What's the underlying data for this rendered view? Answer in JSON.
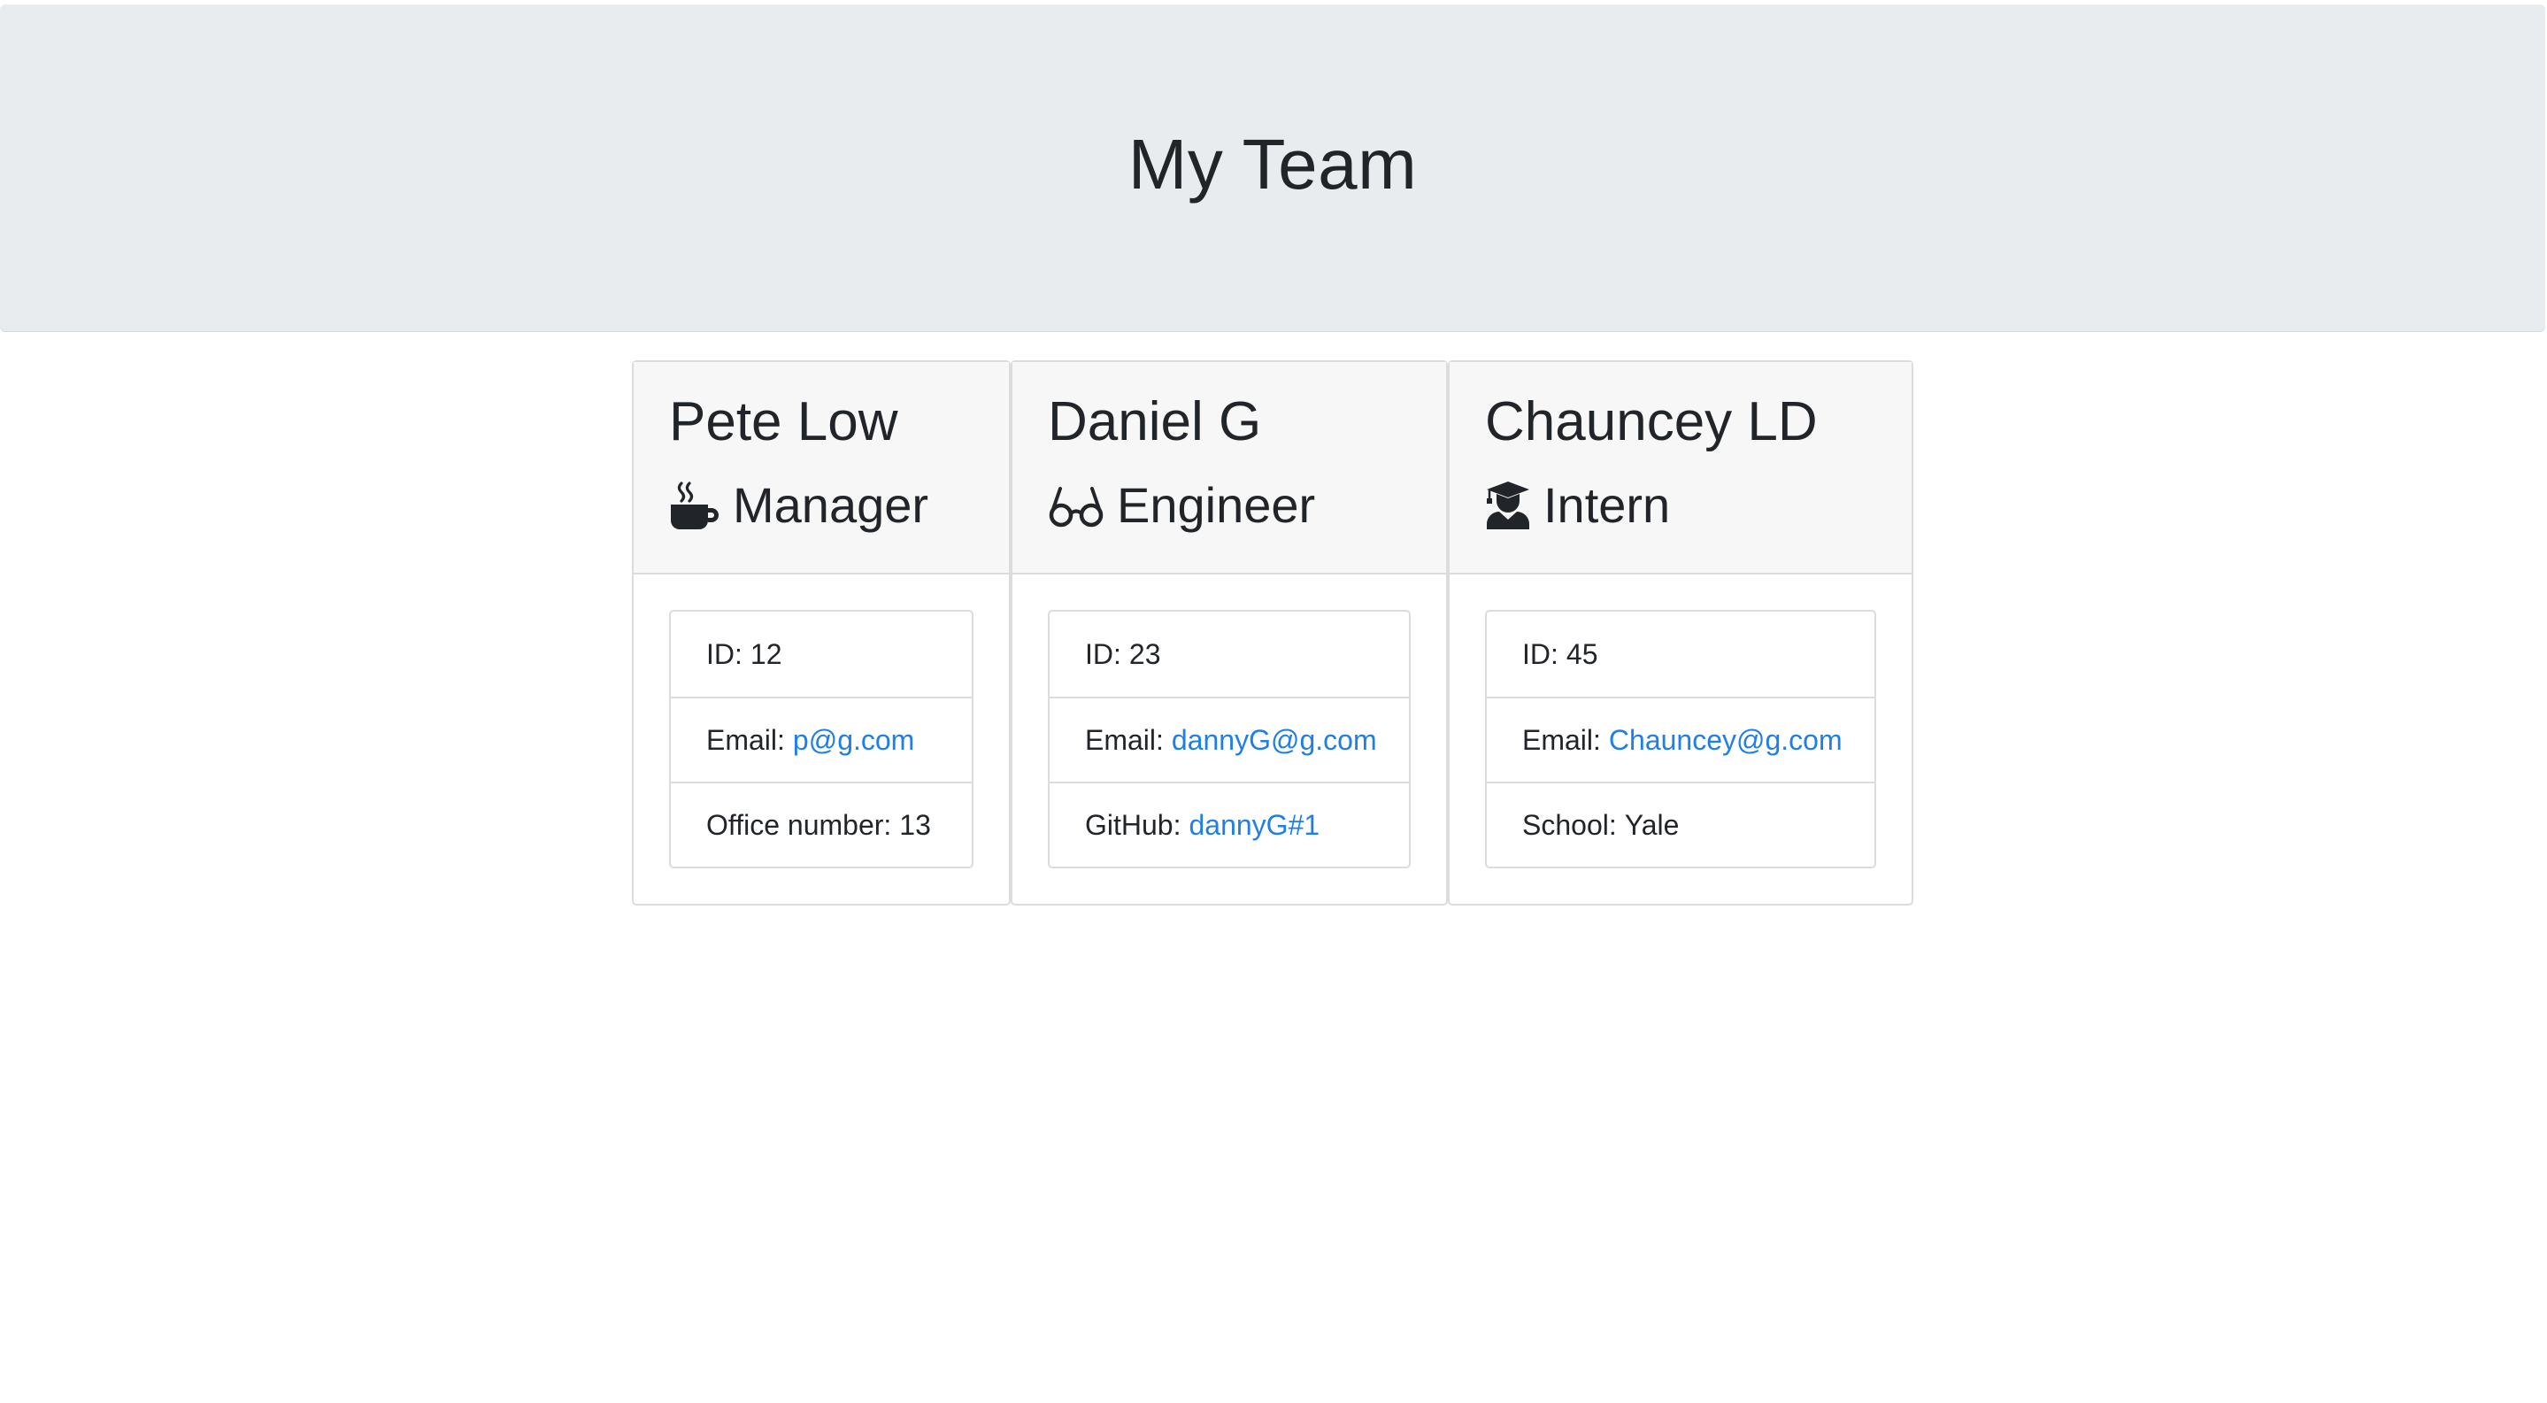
{
  "header": {
    "title": "My Team"
  },
  "team": [
    {
      "name": "Pete Low",
      "role": "Manager",
      "role_icon": "mug-hot-icon",
      "id_label": "ID:",
      "id": "12",
      "email_label": "Email:",
      "email": "p@g.com",
      "extra_label": "Office number:",
      "extra_value": "13"
    },
    {
      "name": "Daniel G",
      "role": "Engineer",
      "role_icon": "glasses-icon",
      "id_label": "ID:",
      "id": "23",
      "email_label": "Email:",
      "email": "dannyG@g.com",
      "extra_label": "GitHub:",
      "extra_value": "dannyG#1"
    },
    {
      "name": "Chauncey LD",
      "role": "Intern",
      "role_icon": "user-graduate-icon",
      "id_label": "ID:",
      "id": "45",
      "email_label": "Email:",
      "email": "Chauncey@g.com",
      "extra_label": "School:",
      "extra_value": "Yale"
    }
  ],
  "colors": {
    "jumbotron_bg": "#e9ecef",
    "card_header_bg": "#f7f7f7",
    "link": "#1f7fe5",
    "text": "#212529",
    "border": "#dcdcdc"
  }
}
